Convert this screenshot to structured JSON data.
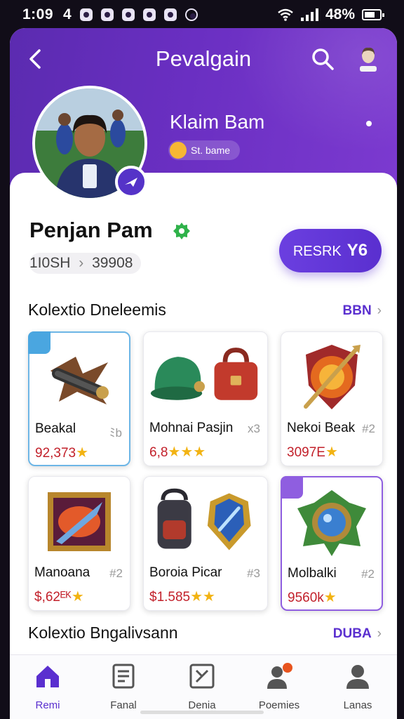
{
  "status_bar": {
    "time": "1:09",
    "extra": "4",
    "battery_percent": "48%"
  },
  "header": {
    "title": "Pevalgain",
    "back_icon": "chevron-left-icon",
    "search_icon": "search-icon",
    "profile_icon": "user-icon"
  },
  "hero": {
    "name": "Klaim Bam",
    "pill_text": "St. bame"
  },
  "profile": {
    "name": "Penjan Pam",
    "stats_left": "1I0SH",
    "stats_sep": "›",
    "stats_right": "39908",
    "cta_label": "RESRK",
    "cta_value": "Y6"
  },
  "section1": {
    "title": "Kolextio Dneleemis",
    "link": "BBN",
    "items": [
      {
        "name": "Beakal",
        "count": "ﾐb",
        "price": "92,373",
        "stars": "★"
      },
      {
        "name": "Mohnai Pasjin",
        "count": "x3",
        "price": "6,8",
        "stars": "★★★"
      },
      {
        "name": "Nekoi Beak",
        "count": "#2",
        "price": "3097E",
        "stars": "★"
      },
      {
        "name": "Manoana",
        "count": "#2",
        "price": "$,62ᴱᴷ",
        "stars": "★"
      },
      {
        "name": "Boroia Picar",
        "count": "#3",
        "price": "$1.585",
        "stars": "★★"
      },
      {
        "name": "Molbalki",
        "count": "#2",
        "price": "9560k",
        "stars": "★"
      }
    ]
  },
  "section2": {
    "title": "Kolextio Bngalivsann",
    "link": "DUBA"
  },
  "nav": [
    {
      "label": "Remi",
      "icon": "home-icon"
    },
    {
      "label": "Fanal",
      "icon": "document-icon"
    },
    {
      "label": "Denia",
      "icon": "tools-icon"
    },
    {
      "label": "Poemies",
      "icon": "people-icon"
    },
    {
      "label": "Lanas",
      "icon": "person-icon"
    }
  ],
  "colors": {
    "accent": "#5a2fcf",
    "header_gradient_start": "#5b2bb0",
    "header_gradient_end": "#7c3ad0",
    "price": "#c2202a",
    "star": "#f2b313"
  }
}
